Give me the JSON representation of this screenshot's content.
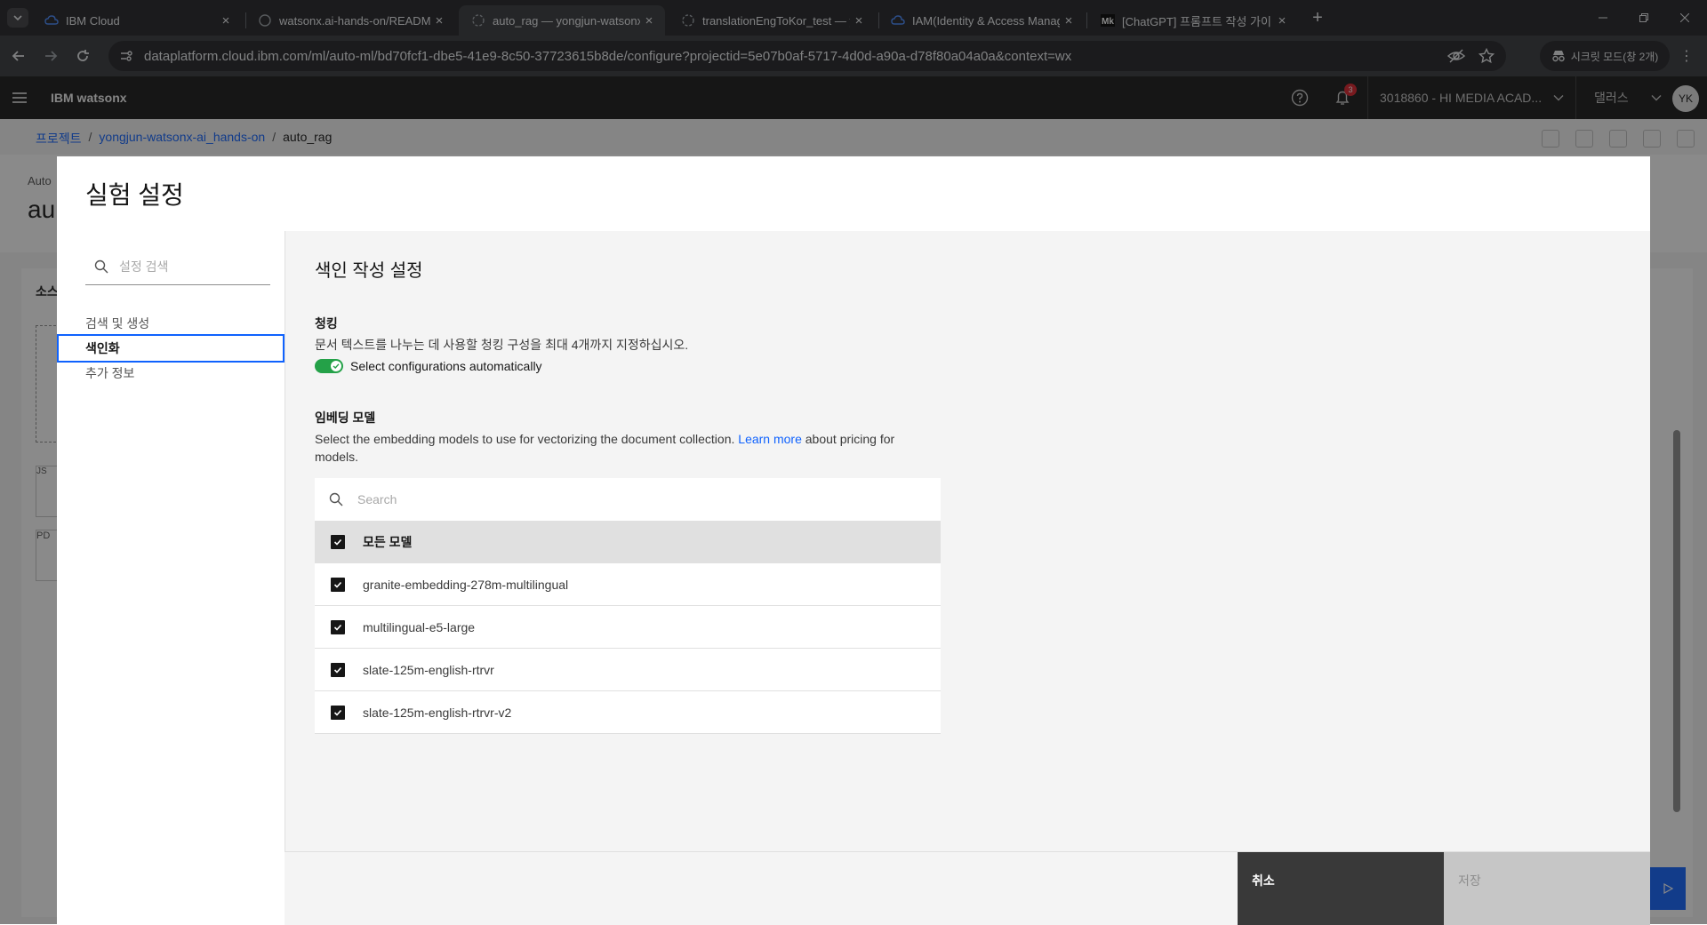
{
  "browser": {
    "tabs": [
      {
        "title": "IBM Cloud",
        "active": false
      },
      {
        "title": "watsonx.ai-hands-on/README",
        "active": false
      },
      {
        "title": "auto_rag — yongjun-watsonx-",
        "active": true
      },
      {
        "title": "translationEngToKor_test — yo",
        "active": false
      },
      {
        "title": "IAM(Identity & Access Manag",
        "active": false
      },
      {
        "title": "[ChatGPT] 프롬프트 작성 가이",
        "active": false
      }
    ],
    "url": "dataplatform.cloud.ibm.com/ml/auto-ml/bd70fcf1-dbe5-41e9-8c50-37723615b8de/configure?projectid=5e07b0af-5717-4d0d-a90a-d78f80a04a0a&context=wx",
    "incognito_label": "시크릿 모드(창 2개)"
  },
  "header": {
    "brand": "IBM watsonx",
    "notification_count": "3",
    "account": "3018860 - HI MEDIA ACAD...",
    "region": "댈러스",
    "avatar": "YK"
  },
  "background": {
    "breadcrumb": {
      "project": "프로젝트",
      "sep": "/",
      "item": "yongjun-watsonx-ai_hands-on",
      "current": "auto_rag"
    },
    "subtitle": "Auto",
    "title": "au",
    "panel_header": "소스",
    "card1": "JS",
    "card2": "PD"
  },
  "modal": {
    "title": "실험 설정",
    "sidebar": {
      "search_placeholder": "설정 검색",
      "items": [
        {
          "label": "검색 및 생성",
          "active": false
        },
        {
          "label": "색인화",
          "active": true
        },
        {
          "label": "추가 정보",
          "active": false
        }
      ]
    },
    "section_title": "색인 작성 설정",
    "chunking": {
      "heading": "청킹",
      "description": "문서 텍스트를 나누는 데 사용할 청킹 구성을 최대 4개까지 지정하십시오.",
      "toggle_label": "Select configurations automatically",
      "toggle_on": true
    },
    "embedding": {
      "heading": "임베딩 모델",
      "description_pre": "Select the embedding models to use for vectorizing the document collection. ",
      "link": "Learn more",
      "description_post": " about pricing for models.",
      "search_placeholder": "Search",
      "all_label": "모든 모델",
      "models": [
        "granite-embedding-278m-multilingual",
        "multilingual-e5-large",
        "slate-125m-english-rtrvr",
        "slate-125m-english-rtrvr-v2"
      ]
    },
    "footer": {
      "cancel": "취소",
      "save": "저장"
    }
  },
  "colors": {
    "primary": "#0f62fe",
    "toggle_on": "#24a148",
    "header_bg": "#161616"
  }
}
